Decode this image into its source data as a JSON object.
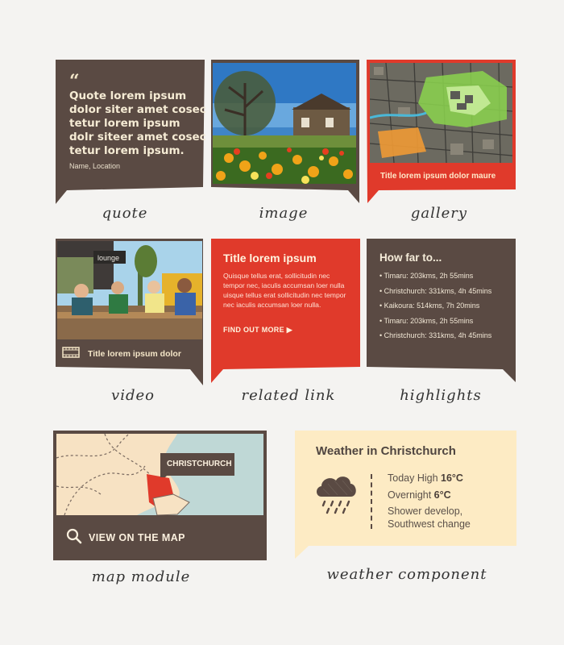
{
  "quote": {
    "mark": "“",
    "text": "Quote lorem ipsum dolor siter amet cosec tetur lorem ipsum dolr siteer amet cosec tetur lorem ipsum.",
    "attribution": "Name, Location",
    "caption": "quote"
  },
  "image": {
    "caption": "image"
  },
  "gallery": {
    "title": "Title lorem ipsum dolor maure",
    "caption": "gallery"
  },
  "video": {
    "title": "Title lorem ipsum dolor",
    "caption": "video"
  },
  "related": {
    "title": "Title lorem ipsum",
    "body": "Quisque tellus erat, sollicitudin nec tempor nec, iaculis accumsan loer nulla uisque tellus erat sollicitudin nec tempor nec iaculis accumsan loer nulla.",
    "link": "FIND OUT MORE ▶",
    "caption": "related link"
  },
  "highlights": {
    "title": "How far to...",
    "items": [
      "• Timaru: 203kms, 2h 55mins",
      "• Christchurch: 331kms, 4h 45mins",
      "• Kaikoura: 514kms, 7h 20mins",
      "• Timaru: 203kms, 2h 55mins",
      "• Christchurch: 331kms, 4h 45mins"
    ],
    "caption": "highlights"
  },
  "map": {
    "label": "CHRISTCHURCH",
    "link": "VIEW ON THE MAP",
    "caption": "map module"
  },
  "weather": {
    "title": "Weather in Christchurch",
    "high_label": "Today High ",
    "high_value": "16°C",
    "overnight_label": "Overnight ",
    "overnight_value": "6°C",
    "summary_line1": "Shower develop,",
    "summary_line2": "Southwest change",
    "caption": "weather component"
  },
  "colors": {
    "brown": "#5a4a43",
    "red": "#e03a2b",
    "cream": "#fdebc4"
  },
  "icons": [
    "quote-icon",
    "film-icon",
    "search-icon",
    "rain-cloud-icon",
    "play-arrow-icon"
  ]
}
